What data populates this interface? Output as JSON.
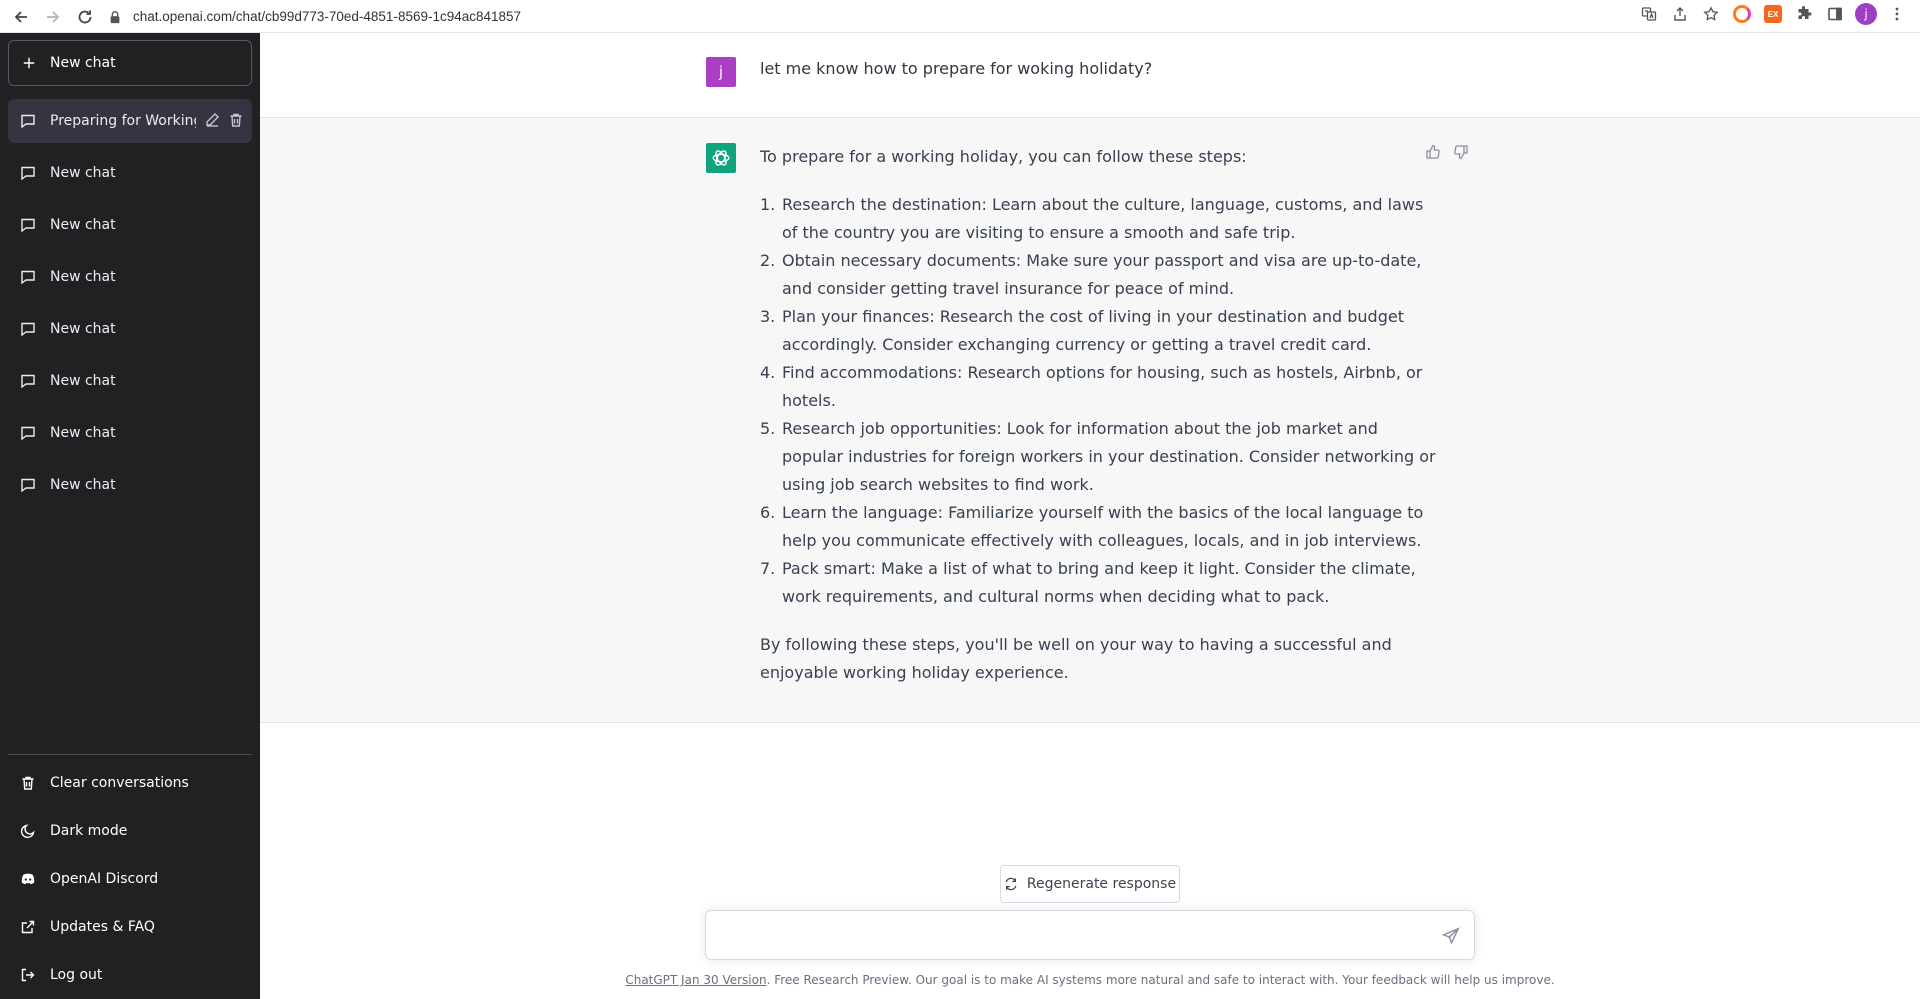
{
  "browser": {
    "url": "chat.openai.com/chat/cb99d773-70ed-4851-8569-1c94ac841857",
    "profile_initial": "j",
    "ext_badge": "EX"
  },
  "sidebar": {
    "new_chat_label": "New chat",
    "history": [
      {
        "label": "Preparing for Working",
        "active": true
      },
      {
        "label": "New chat"
      },
      {
        "label": "New chat"
      },
      {
        "label": "New chat"
      },
      {
        "label": "New chat"
      },
      {
        "label": "New chat"
      },
      {
        "label": "New chat"
      },
      {
        "label": "New chat"
      }
    ],
    "bottom": {
      "clear": "Clear conversations",
      "dark_mode": "Dark mode",
      "discord": "OpenAI Discord",
      "faq": "Updates & FAQ",
      "logout": "Log out"
    }
  },
  "conversation": {
    "user_initial": "j",
    "user_message": "let me know how to prepare for woking holidaty?",
    "bot_intro": "To prepare for a working holiday, you can follow these steps:",
    "steps": [
      {
        "num": "1.",
        "text": "Research the destination: Learn about the culture, language, customs, and laws of the country you are visiting to ensure a smooth and safe trip."
      },
      {
        "num": "2.",
        "text": "Obtain necessary documents: Make sure your passport and visa are up-to-date, and consider getting travel insurance for peace of mind."
      },
      {
        "num": "3.",
        "text": "Plan your finances: Research the cost of living in your destination and budget accordingly. Consider exchanging currency or getting a travel credit card."
      },
      {
        "num": "4.",
        "text": "Find accommodations: Research options for housing, such as hostels, Airbnb, or hotels."
      },
      {
        "num": "5.",
        "text": "Research job opportunities: Look for information about the job market and popular industries for foreign workers in your destination. Consider networking or using job search websites to find work."
      },
      {
        "num": "6.",
        "text": "Learn the language: Familiarize yourself with the basics of the local language to help you communicate effectively with colleagues, locals, and in job interviews."
      },
      {
        "num": "7.",
        "text": "Pack smart: Make a list of what to bring and keep it light. Consider the climate, work requirements, and cultural norms when deciding what to pack."
      }
    ],
    "bot_outro": "By following these steps, you'll be well on your way to having a successful and enjoyable working holiday experience."
  },
  "composer": {
    "regenerate_label": "Regenerate response",
    "input_value": "",
    "footer_link": "ChatGPT Jan 30 Version",
    "footer_text": ". Free Research Preview. Our goal is to make AI systems more natural and safe to interact with. Your feedback will help us improve."
  },
  "colors": {
    "sidebar_bg": "#202123",
    "active_item_bg": "#343541",
    "bot_row_bg": "#f7f7f8",
    "bot_avatar": "#10a37f",
    "user_avatar": "#ab3ec2"
  },
  "icons": {
    "back": "arrow-left-icon",
    "forward": "arrow-right-icon",
    "reload": "reload-icon",
    "lock": "lock-icon",
    "chat": "message-bubble-icon",
    "edit": "pencil-icon",
    "delete": "trash-icon",
    "thumbs_up": "thumbs-up-icon",
    "thumbs_down": "thumbs-down-icon",
    "send": "send-icon"
  }
}
